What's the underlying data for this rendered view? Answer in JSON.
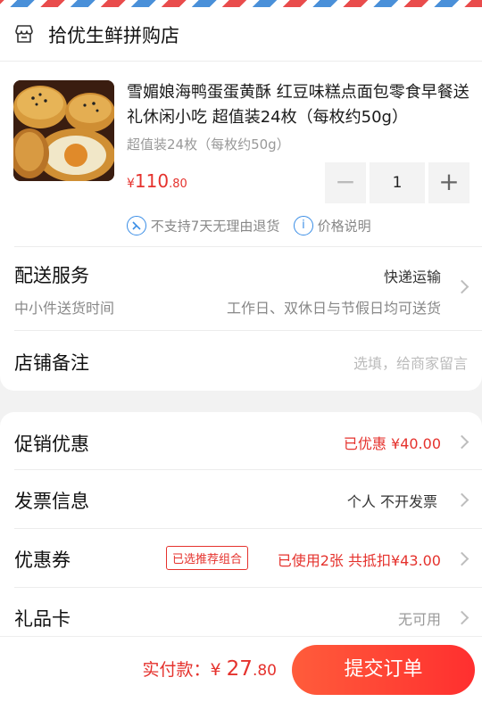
{
  "store": {
    "name": "拾优生鲜拼购店",
    "icon": "store-icon"
  },
  "product": {
    "title": "雪媚娘海鸭蛋蛋黄酥 红豆味糕点面包零食早餐送礼休闲小吃 超值装24枚（每枚约50g）",
    "spec": "超值装24枚（每枚约50g）",
    "price_currency": "¥",
    "price_int": "110",
    "price_dec": ".80",
    "quantity": "1",
    "minus_label": "−",
    "plus_label": "+",
    "policy_no_return": "不支持7天无理由退货",
    "policy_price_note": "价格说明"
  },
  "delivery": {
    "label": "配送服务",
    "method": "快递运输",
    "sub_label": "中小件送货时间",
    "schedule": "工作日、双休日与节假日均可送货"
  },
  "note": {
    "label": "店铺备注",
    "placeholder": "选填，给商家留言"
  },
  "promotion": {
    "label": "促销优惠",
    "value": "已优惠 ¥40.00"
  },
  "invoice": {
    "label": "发票信息",
    "value": "个人 不开发票"
  },
  "coupon": {
    "label": "优惠券",
    "tag": "已选推荐组合",
    "value": "已使用2张 共抵扣¥43.00"
  },
  "gift_card": {
    "label": "礼品卡",
    "value": "无可用"
  },
  "bottom": {
    "pay_label": "实付款：",
    "currency": "¥",
    "amount_int": "27",
    "amount_dec": ".80",
    "submit_label": "提交订单"
  },
  "colors": {
    "accent_red": "#e5322d",
    "info_blue": "#3b8ee6"
  }
}
